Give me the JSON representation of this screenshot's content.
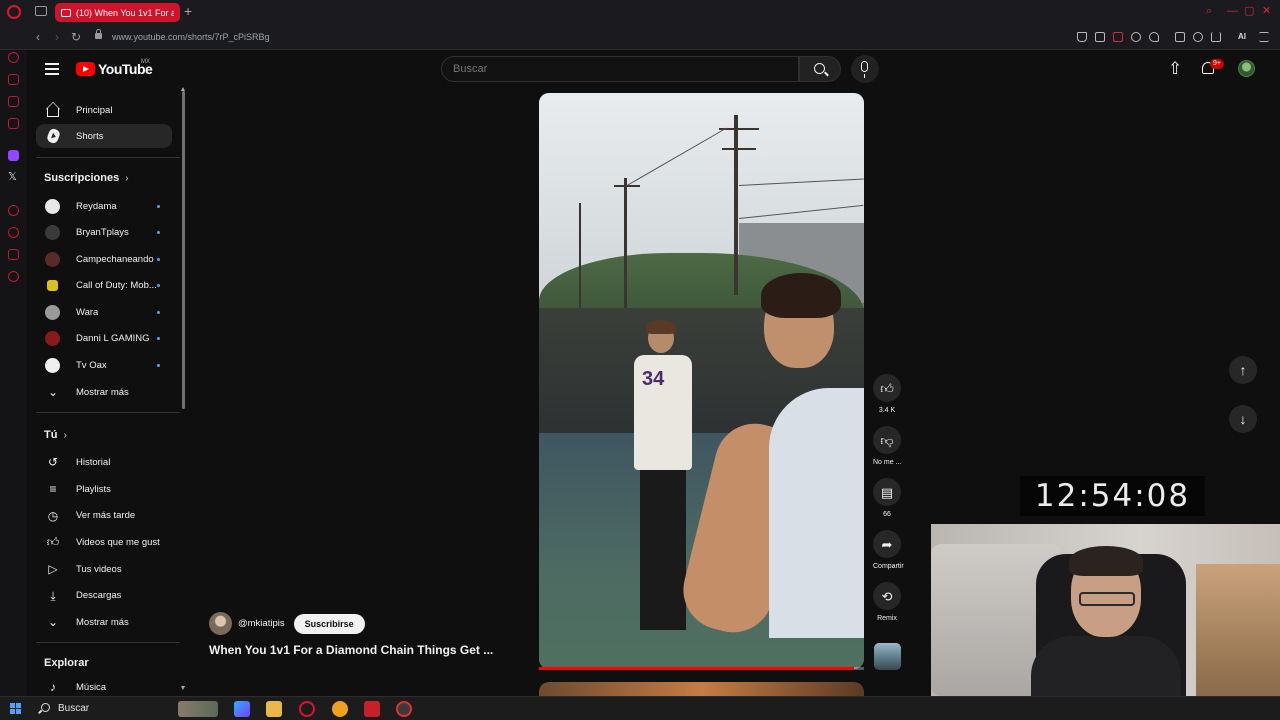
{
  "browser": {
    "tab_title": "(10) When You 1v1 For a Di",
    "url": "www.youtube.com/shorts/7rP_cPiSRBg",
    "ext_ai_label": "AI",
    "colors": {
      "accent": "#d0132c"
    }
  },
  "header": {
    "logo_text": "YouTube",
    "region": "MX",
    "search_placeholder": "Buscar",
    "notification_badge": "9+"
  },
  "sidebar": {
    "main": [
      {
        "label": "Principal",
        "icon": "home-icon"
      },
      {
        "label": "Shorts",
        "icon": "shorts-icon",
        "active": true
      }
    ],
    "subscriptions_title": "Suscripciones",
    "subscriptions": [
      {
        "label": "Reydama",
        "avatar_color": "#e8e8e8"
      },
      {
        "label": "BryanTplays",
        "avatar_color": "#3a3a3a"
      },
      {
        "label": "Campechaneando",
        "avatar_color": "#5a2a2a"
      },
      {
        "label": "Call of Duty: Mob...",
        "avatar_color": "#d9c020"
      },
      {
        "label": "Wara",
        "avatar_color": "#9a9a9a"
      },
      {
        "label": "Danni L GAMING",
        "avatar_color": "#8a1a1a"
      },
      {
        "label": "Tv Oax",
        "avatar_color": "#f0f0f0"
      }
    ],
    "show_more": "Mostrar más",
    "you_title": "Tú",
    "you_items": [
      {
        "label": "Historial",
        "icon": "history-icon"
      },
      {
        "label": "Playlists",
        "icon": "playlists-icon"
      },
      {
        "label": "Ver más tarde",
        "icon": "watch-later-icon"
      },
      {
        "label": "Videos que me gust...",
        "icon": "liked-icon"
      },
      {
        "label": "Tus videos",
        "icon": "your-videos-icon"
      },
      {
        "label": "Descargas",
        "icon": "download-icon"
      }
    ],
    "show_more_2": "Mostrar más",
    "explore_title": "Explorar",
    "explore_items": [
      {
        "label": "Música",
        "icon": "music-icon"
      }
    ]
  },
  "short": {
    "channel": "@mkiatipis",
    "subscribe_label": "Suscribirse",
    "title": "When You 1v1 For a Diamond Chain Things Get ...",
    "progress": 0.97,
    "actions": {
      "likes": "3.4 K",
      "dislike_label": "No me ...",
      "comments": "66",
      "share_label": "Compartir",
      "remix_label": "Remix"
    }
  },
  "overlay": {
    "clock": "12:54:08"
  },
  "taskbar": {
    "search_label": "Buscar"
  }
}
